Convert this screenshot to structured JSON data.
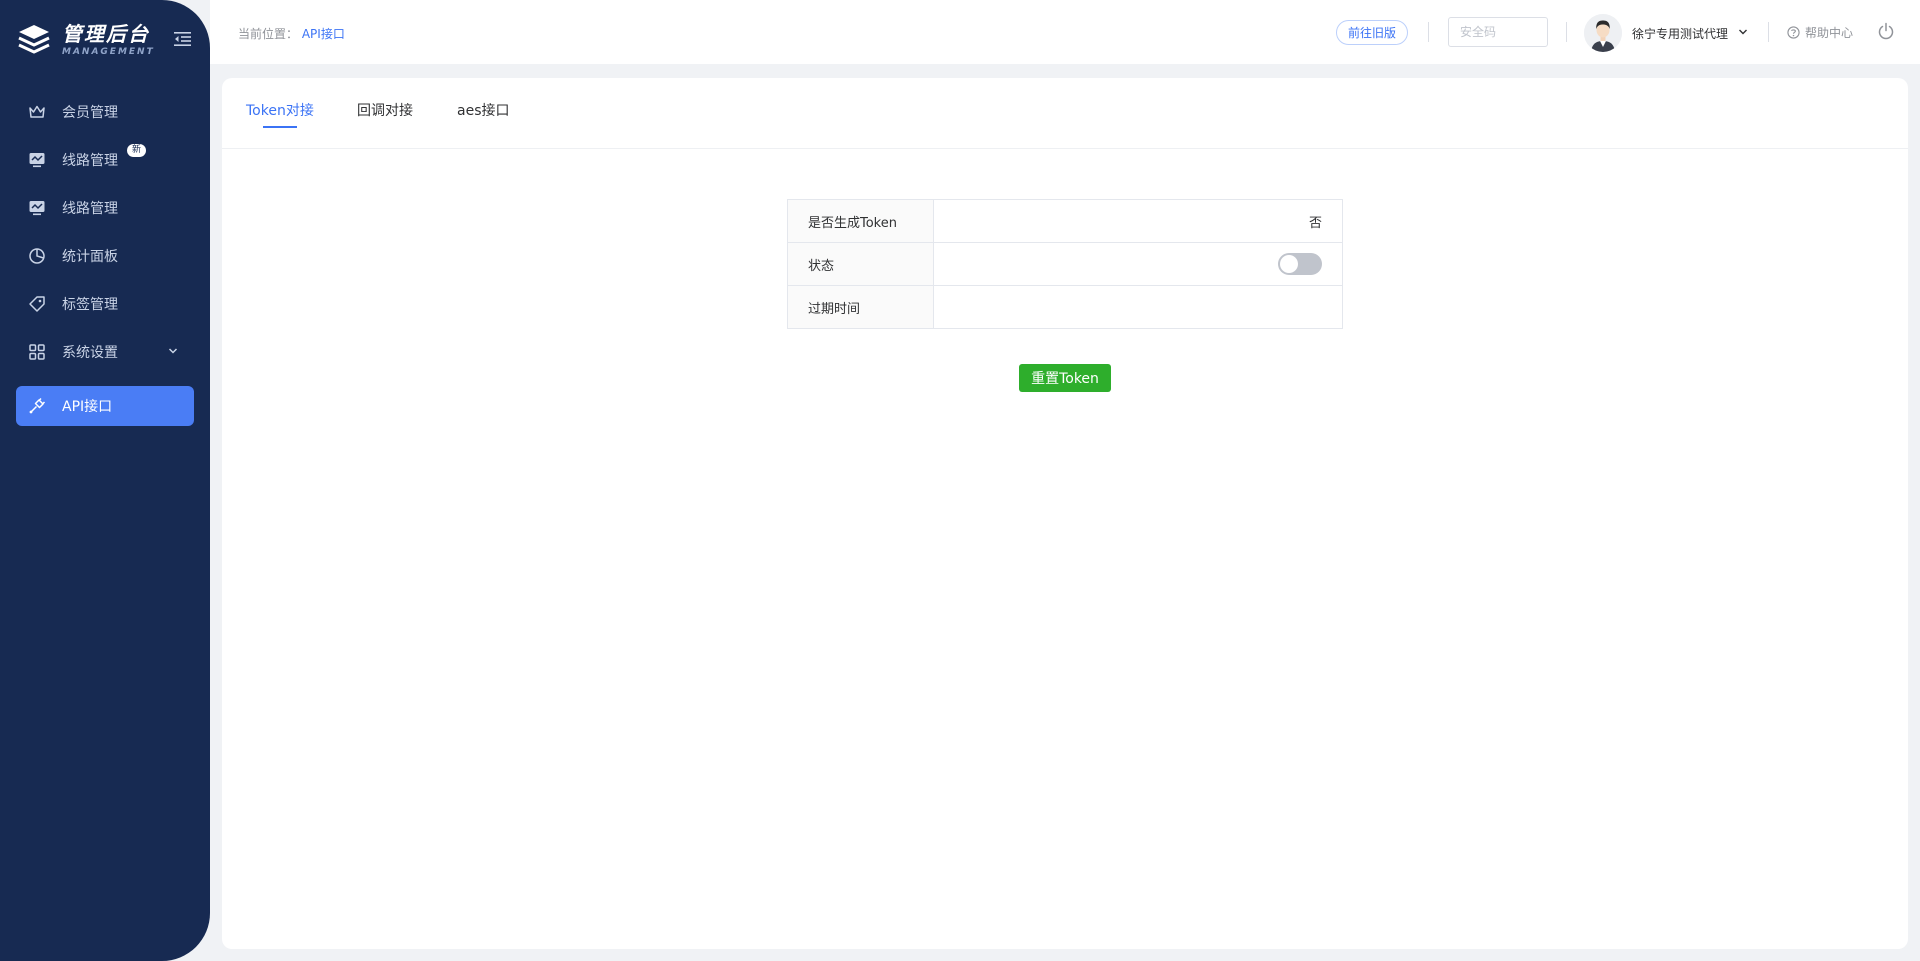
{
  "sidebar": {
    "logo": {
      "title": "管理后台",
      "subtitle": "MANAGEMENT"
    },
    "items": [
      {
        "label": "会员管理",
        "icon": "crown-icon"
      },
      {
        "label": "线路管理",
        "icon": "monitor-icon",
        "badge": "新"
      },
      {
        "label": "线路管理",
        "icon": "monitor-icon"
      },
      {
        "label": "统计面板",
        "icon": "pie-chart-icon"
      },
      {
        "label": "标签管理",
        "icon": "tag-icon"
      },
      {
        "label": "系统设置",
        "icon": "grid-icon",
        "expandable": true
      },
      {
        "label": "API接口",
        "icon": "plug-icon",
        "active": true
      }
    ]
  },
  "header": {
    "breadcrumb_prefix": "当前位置：",
    "breadcrumb_current": "API接口",
    "old_version_label": "前往旧版",
    "security_placeholder": "安全码",
    "user_name": "徐宁专用测试代理",
    "help_label": "帮助中心"
  },
  "tabs": [
    {
      "label": "Token对接",
      "active": true
    },
    {
      "label": "回调对接"
    },
    {
      "label": "aes接口"
    }
  ],
  "token_table": {
    "rows": [
      {
        "label": "是否生成Token",
        "value": "否"
      },
      {
        "label": "状态",
        "switch_on": false
      },
      {
        "label": "过期时间",
        "value": ""
      }
    ]
  },
  "reset_button_label": "重置Token",
  "colors": {
    "sidebar_bg": "#172a52",
    "accent": "#3b73f5",
    "active_menu": "#4a7df5",
    "reset_button": "#2eae2c"
  }
}
